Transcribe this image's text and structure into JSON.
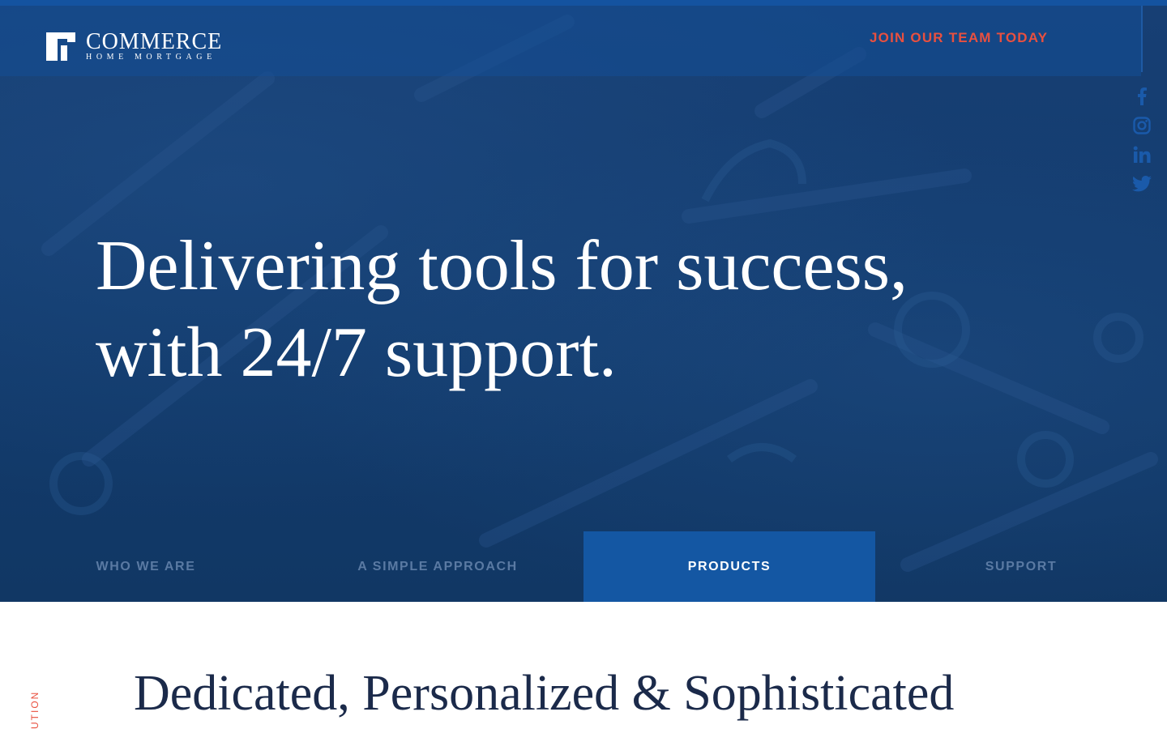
{
  "brand": {
    "name": "COMMERCE",
    "tagline": "HOME MORTGAGE"
  },
  "header": {
    "cta_label": "JOIN OUR TEAM TODAY"
  },
  "social": {
    "icons": [
      "facebook-icon",
      "instagram-icon",
      "linkedin-icon",
      "twitter-icon"
    ]
  },
  "hero": {
    "headline_line1": "Delivering tools for success,",
    "headline_line2": "with 24/7 support."
  },
  "tabs": [
    {
      "label": "WHO WE ARE",
      "active": false
    },
    {
      "label": "A SIMPLE APPROACH",
      "active": false
    },
    {
      "label": "PRODUCTS",
      "active": true
    },
    {
      "label": "SUPPORT",
      "active": false
    }
  ],
  "section": {
    "side_label": "UTION",
    "title": "Dedicated, Personalized & Sophisticated"
  },
  "colors": {
    "hero_blue": "#123c70",
    "accent_red": "#e9503f",
    "active_tab": "#1457a3",
    "text_dark": "#1b2a4a"
  }
}
